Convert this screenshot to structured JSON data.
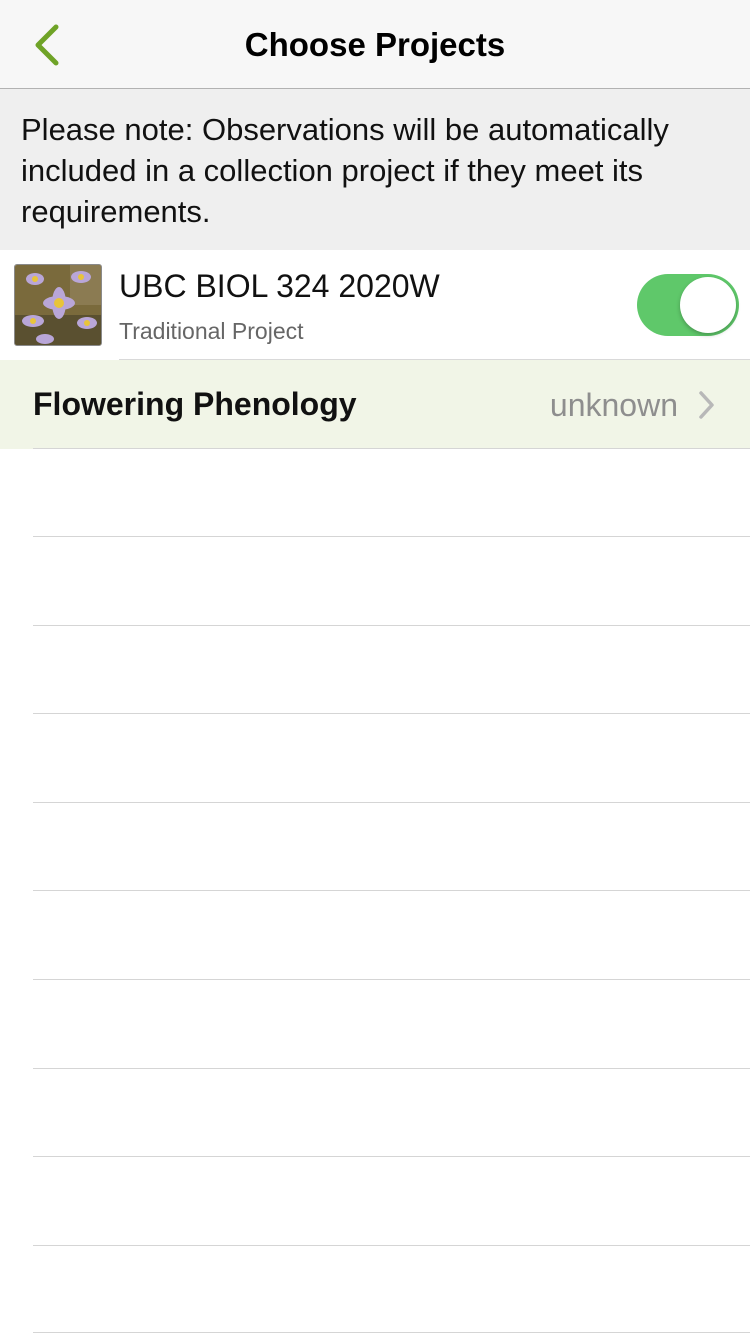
{
  "nav": {
    "title": "Choose Projects",
    "back_icon": "chevron-left-icon"
  },
  "note": {
    "text": "Please note: Observations will be automatically included in a collection project if they meet its requirements."
  },
  "project": {
    "name": "UBC BIOL 324 2020W",
    "type": "Traditional Project",
    "enabled": true
  },
  "field": {
    "label": "Flowering Phenology",
    "value": "unknown"
  },
  "colors": {
    "accent": "#6fa327",
    "toggle_on": "#5fc86a",
    "field_row_bg": "#f1f5e7"
  }
}
